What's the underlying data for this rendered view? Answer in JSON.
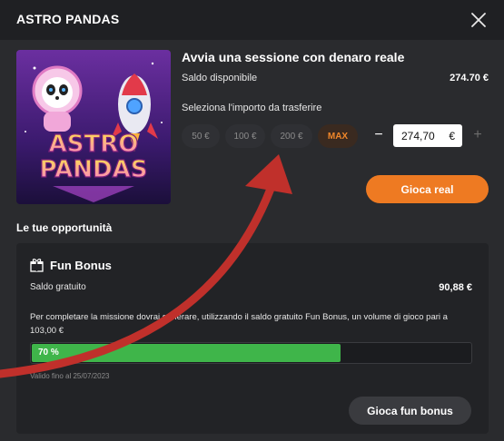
{
  "header": {
    "title": "ASTRO PANDAS"
  },
  "game": {
    "thumbnail_title_line1": "ASTRO",
    "thumbnail_title_line2": "PANDAS"
  },
  "session": {
    "title": "Avvia una sessione con denaro reale",
    "saldo_label": "Saldo disponibile",
    "saldo_value": "274.70 €",
    "select_label": "Seleziona l'importo da trasferire",
    "amounts": [
      "50 €",
      "100 €",
      "200 €",
      "MAX"
    ],
    "amount_value": "274,70",
    "currency": "€",
    "minus": "−",
    "plus": "+",
    "play_real_label": "Gioca real"
  },
  "opportunities": {
    "title": "Le tue opportunità",
    "bonus_name": "Fun Bonus",
    "free_label": "Saldo gratuito",
    "free_value": "90,88 €",
    "mission_text": "Per completare la missione dovrai generare, utilizzando il saldo gratuito Fun Bonus, un volume di gioco pari a 103,00 €",
    "progress_label": "70 %",
    "progress_fraction": 0.7,
    "valid_until": "Valido fino al 25/07/2023",
    "play_fun_label": "Gioca fun bonus"
  },
  "colors": {
    "accent": "#ee7a22",
    "progress": "#3fb54a",
    "annotation_arrow": "#c0302b"
  }
}
